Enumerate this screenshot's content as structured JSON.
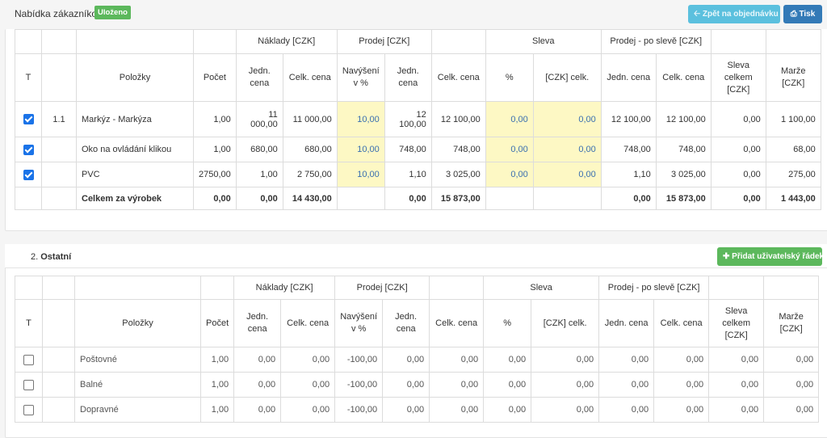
{
  "header": {
    "title": "Nabídka zákazníkovi",
    "badge": "Uloženo",
    "back_label": "Zpět na objednávku",
    "print_label": "Tisk",
    "back_icon": "arrow-left-icon",
    "print_icon": "printer-icon"
  },
  "columns": {
    "groups": {
      "naklady": "Náklady [CZK]",
      "prodej": "Prodej [CZK]",
      "sleva": "Sleva",
      "prodej_po_sleve": "Prodej - po slevě [CZK]"
    },
    "t": "T",
    "polozky": "Položky",
    "pocet": "Počet",
    "jedn_cena": "Jedn. cena",
    "celk_cena": "Celk. cena",
    "navyseni": "Navýšení v %",
    "pct": "%",
    "czk_celk": "[CZK] celk.",
    "sleva_celkem": "Sleva celkem [CZK]",
    "marze": "Marže [CZK]"
  },
  "section1": {
    "rows": [
      {
        "checked": true,
        "no": "1.1",
        "name": "Markýz - Markýza",
        "pocet": "1,00",
        "n_jedn": "11 000,00",
        "n_celk": "11 000,00",
        "navyseni": "10,00",
        "p_jedn": "12 100,00",
        "p_celk": "12 100,00",
        "sleva_pct": "0,00",
        "sleva_czk": "0,00",
        "ps_jedn": "12 100,00",
        "ps_celk": "12 100,00",
        "sleva_celkem": "0,00",
        "marze": "1 100,00"
      },
      {
        "checked": true,
        "no": "",
        "name": "Oko na ovládání klikou",
        "pocet": "1,00",
        "n_jedn": "680,00",
        "n_celk": "680,00",
        "navyseni": "10,00",
        "p_jedn": "748,00",
        "p_celk": "748,00",
        "sleva_pct": "0,00",
        "sleva_czk": "0,00",
        "ps_jedn": "748,00",
        "ps_celk": "748,00",
        "sleva_celkem": "0,00",
        "marze": "68,00"
      },
      {
        "checked": true,
        "no": "",
        "name": "PVC",
        "pocet": "2750,00",
        "n_jedn": "1,00",
        "n_celk": "2 750,00",
        "navyseni": "10,00",
        "p_jedn": "1,10",
        "p_celk": "3 025,00",
        "sleva_pct": "0,00",
        "sleva_czk": "0,00",
        "ps_jedn": "1,10",
        "ps_celk": "3 025,00",
        "sleva_celkem": "0,00",
        "marze": "275,00"
      }
    ],
    "total": {
      "label": "Celkem za výrobek",
      "pocet": "0,00",
      "n_jedn": "0,00",
      "n_celk": "14 430,00",
      "p_jedn": "0,00",
      "p_celk": "15 873,00",
      "ps_jedn": "0,00",
      "ps_celk": "15 873,00",
      "sleva_celkem": "0,00",
      "marze": "1 443,00"
    }
  },
  "section2": {
    "number": "2.",
    "title": "Ostatní",
    "add_label": "Přidat uživatelský řádek",
    "add_icon": "plus-icon",
    "rows": [
      {
        "checked": false,
        "name": "Poštovné",
        "pocet": "1,00",
        "n_jedn": "0,00",
        "n_celk": "0,00",
        "navyseni": "-100,00",
        "p_jedn": "0,00",
        "p_celk": "0,00",
        "sleva_pct": "0,00",
        "sleva_czk": "0,00",
        "ps_jedn": "0,00",
        "ps_celk": "0,00",
        "sleva_celkem": "0,00",
        "marze": "0,00"
      },
      {
        "checked": false,
        "name": "Balné",
        "pocet": "1,00",
        "n_jedn": "0,00",
        "n_celk": "0,00",
        "navyseni": "-100,00",
        "p_jedn": "0,00",
        "p_celk": "0,00",
        "sleva_pct": "0,00",
        "sleva_czk": "0,00",
        "ps_jedn": "0,00",
        "ps_celk": "0,00",
        "sleva_celkem": "0,00",
        "marze": "0,00"
      },
      {
        "checked": false,
        "name": "Dopravné",
        "pocet": "1,00",
        "n_jedn": "0,00",
        "n_celk": "0,00",
        "navyseni": "-100,00",
        "p_jedn": "0,00",
        "p_celk": "0,00",
        "sleva_pct": "0,00",
        "sleva_czk": "0,00",
        "ps_jedn": "0,00",
        "ps_celk": "0,00",
        "sleva_celkem": "0,00",
        "marze": "0,00"
      }
    ]
  }
}
